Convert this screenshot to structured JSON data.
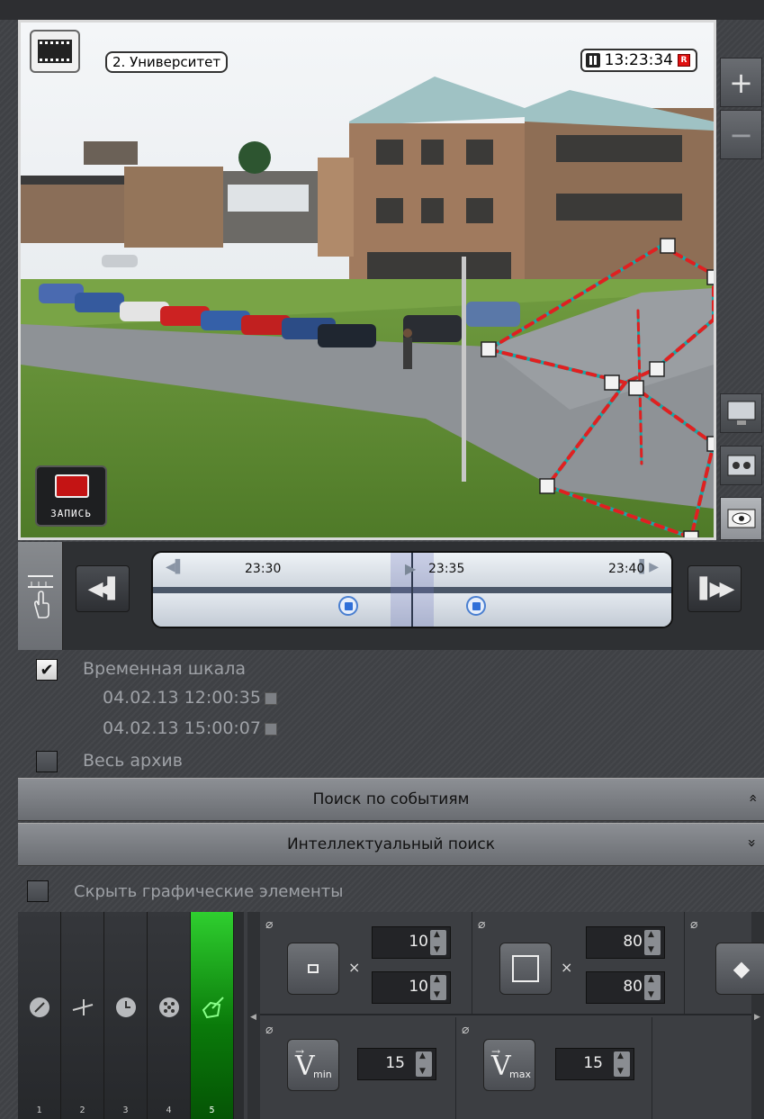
{
  "camera": {
    "name": "2. Университет",
    "time": "13:23:34",
    "rec_indicator": "R",
    "record_button_label": "ЗАПИСЬ"
  },
  "zoom": {
    "in": "+",
    "out": "−"
  },
  "timeline": {
    "ticks": [
      "23:30",
      "23:35",
      "23:40"
    ]
  },
  "settings": {
    "timescale_label": "Временная шкала",
    "timescale_checked": true,
    "date_from": "04.02.13 12:00:35",
    "date_to": "04.02.13 15:00:07",
    "whole_archive_label": "Весь архив",
    "whole_archive_checked": false
  },
  "bars": {
    "event_search": "Поиск по событиям",
    "event_search_chevron": "»",
    "smart_search": "Интеллектуальный поиск",
    "smart_search_chevron": "»"
  },
  "hide_graphics_label": "Скрыть графические элементы",
  "strips": [
    {
      "num": "1",
      "icon": "arrow-icon"
    },
    {
      "num": "2",
      "icon": "line-cross-icon"
    },
    {
      "num": "3",
      "icon": "clock-icon"
    },
    {
      "num": "4",
      "icon": "dots-icon"
    },
    {
      "num": "5",
      "icon": "zone-icon",
      "active": true
    }
  ],
  "params": {
    "min_size": {
      "w": "10",
      "h": "10"
    },
    "max_size": {
      "w": "80",
      "h": "80"
    },
    "vmin": {
      "label": "V",
      "sub": "min",
      "value": "15"
    },
    "vmax": {
      "label": "V",
      "sub": "max",
      "value": "15"
    },
    "times_symbol": "×"
  },
  "colors": {
    "active_strip": "#1fa81f",
    "zone_line_red": "#e02020",
    "zone_line_teal": "#1aa7a7"
  }
}
